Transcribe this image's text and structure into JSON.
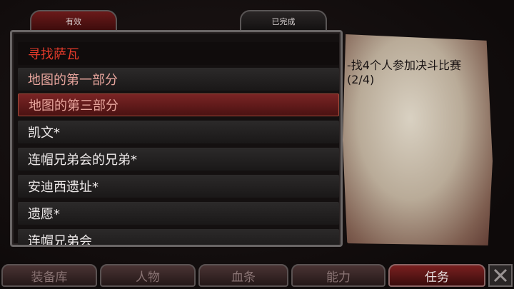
{
  "tabs": {
    "active": "有效",
    "completed": "已完成"
  },
  "quests": {
    "header": "寻找萨瓦",
    "items": [
      "地图的第一部分",
      "地图的第三部分",
      "凯文*",
      "连帽兄弟会的兄弟*",
      "安迪西遗址*",
      "遗愿*",
      "连帽兄弟会"
    ]
  },
  "description": "-找4个人参加决斗比赛 (2/4)",
  "bottom_nav": [
    "装备库",
    "人物",
    "血条",
    "能力",
    "任务"
  ],
  "colors": {
    "accent_red": "#e23a2a",
    "selected_row": "#7a2424"
  }
}
